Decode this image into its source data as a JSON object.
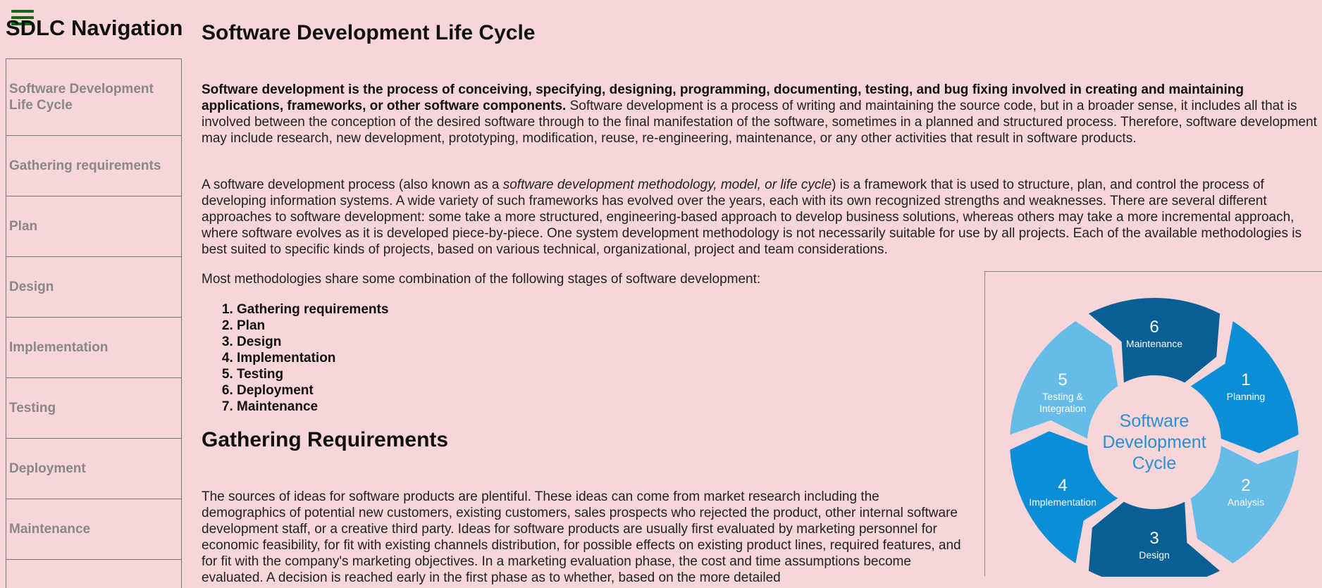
{
  "nav": {
    "title": "SDLC Navigation",
    "items": [
      {
        "label": "Software Development Life Cycle"
      },
      {
        "label": "Gathering requirements"
      },
      {
        "label": "Plan"
      },
      {
        "label": "Design"
      },
      {
        "label": "Implementation"
      },
      {
        "label": "Testing"
      },
      {
        "label": "Deployment"
      },
      {
        "label": "Maintenance"
      },
      {
        "label": ""
      }
    ]
  },
  "main": {
    "title": "Software Development Life Cycle",
    "p1_bold": "Software development is the process of conceiving, specifying, designing, programming, documenting, testing, and bug fixing involved in creating and maintaining applications, frameworks, or other software components.",
    "p1_rest": " Software development is a process of writing and maintaining the source code, but in a broader sense, it includes all that is involved between the conception of the desired software through to the final manifestation of the software, sometimes in a planned and structured process. Therefore, software development may include research, new development, prototyping, modification, reuse, re-engineering, maintenance, or any other activities that result in software products.",
    "p2_a": "A software development process (also known as a ",
    "p2_em": "software development methodology, model, or life cycle",
    "p2_b": ") is a framework that is used to structure, plan, and control the process of developing information systems. A wide variety of such frameworks has evolved over the years, each with its own recognized strengths and weaknesses. There are several different approaches to software development: some take a more structured, engineering-based approach to develop business solutions, whereas others may take a more incremental approach, where software evolves as it is developed piece-by-piece. One system development methodology is not necessarily suitable for use by all projects. Each of the available methodologies is best suited to specific kinds of projects, based on various technical, organizational, project and team considerations.",
    "p3": "Most methodologies share some combination of the following stages of software development:",
    "stages": [
      "Gathering requirements",
      "Plan",
      "Design",
      "Implementation",
      "Testing",
      "Deployment",
      "Maintenance"
    ],
    "h2": "Gathering Requirements",
    "p4": "The sources of ideas for software products are plentiful. These ideas can come from market research including the demographics of potential new customers, existing customers, sales prospects who rejected the product, other internal software development staff, or a creative third party. Ideas for software products are usually first evaluated by marketing personnel for economic feasibility, for fit with existing channels distribution, for possible effects on existing product lines, required features, and for fit with the company's marketing objectives. In a marketing evaluation phase, the cost and time assumptions become evaluated. A decision is reached early in the first phase as to whether, based on the more detailed"
  },
  "diagram": {
    "center": [
      "Software",
      "Development",
      "Cycle"
    ],
    "steps": [
      {
        "num": "1",
        "label": [
          "Planning"
        ],
        "color": "#0b8ed6"
      },
      {
        "num": "2",
        "label": [
          "Analysis"
        ],
        "color": "#66bce8"
      },
      {
        "num": "3",
        "label": [
          "Design"
        ],
        "color": "#085f94"
      },
      {
        "num": "4",
        "label": [
          "Implementation"
        ],
        "color": "#0b8ed6"
      },
      {
        "num": "5",
        "label": [
          "Testing &",
          "Integration"
        ],
        "color": "#66bce8"
      },
      {
        "num": "6",
        "label": [
          "Maintenance"
        ],
        "color": "#085f94"
      }
    ],
    "center_color": "#2a8fd0"
  },
  "colors": {
    "background": "#f6d6d8",
    "menu_icon": "#0c6b12"
  }
}
